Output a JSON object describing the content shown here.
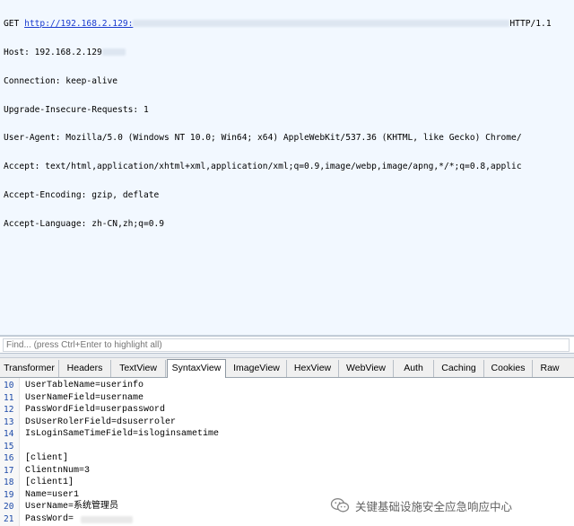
{
  "request": {
    "method": "GET ",
    "url": "http://192.168.2.129:",
    "protocol": "HTTP/1.1",
    "host": "Host: 192.168.2.129",
    "headers": [
      "Connection: keep-alive",
      "Upgrade-Insecure-Requests: 1",
      "User-Agent: Mozilla/5.0 (Windows NT 10.0; Win64; x64) AppleWebKit/537.36 (KHTML, like Gecko) Chrome/",
      "Accept: text/html,application/xhtml+xml,application/xml;q=0.9,image/webp,image/apng,*/*;q=0.8,applic",
      "Accept-Encoding: gzip, deflate",
      "Accept-Language: zh-CN,zh;q=0.9"
    ]
  },
  "find": {
    "placeholder": "Find... (press Ctrl+Enter to highlight all)"
  },
  "tabs": [
    {
      "label": "Transformer",
      "active": false
    },
    {
      "label": "Headers",
      "active": false
    },
    {
      "label": "TextView",
      "active": false
    },
    {
      "label": "SyntaxView",
      "active": true
    },
    {
      "label": "ImageView",
      "active": false
    },
    {
      "label": "HexView",
      "active": false
    },
    {
      "label": "WebView",
      "active": false
    },
    {
      "label": "Auth",
      "active": false
    },
    {
      "label": "Caching",
      "active": false
    },
    {
      "label": "Cookies",
      "active": false
    },
    {
      "label": "Raw",
      "active": false
    }
  ],
  "lines": [
    {
      "num": "10",
      "text": "UserTableName=userinfo"
    },
    {
      "num": "11",
      "text": "UserNameField=username"
    },
    {
      "num": "12",
      "text": "PassWordField=userpassword"
    },
    {
      "num": "13",
      "text": "DsUserRolerField=dsuserroler"
    },
    {
      "num": "14",
      "text": "IsLoginSameTimeField=isloginsametime"
    },
    {
      "num": "15",
      "text": ""
    },
    {
      "num": "16",
      "text": "[client]"
    },
    {
      "num": "17",
      "text": "ClientnNum=3"
    },
    {
      "num": "18",
      "text": "[client1]"
    },
    {
      "num": "19",
      "text": "Name=user1"
    },
    {
      "num": "20",
      "text": "UserName=系统管理员"
    },
    {
      "num": "21",
      "text": "PassWord="
    }
  ],
  "watermark": {
    "text": "关键基础设施安全应急响应中心",
    "icon": "wechat-icon"
  },
  "colors": {
    "request_bg": "#f2f8ff",
    "url": "#1a3bcf",
    "line_number": "#1d4aa8"
  }
}
